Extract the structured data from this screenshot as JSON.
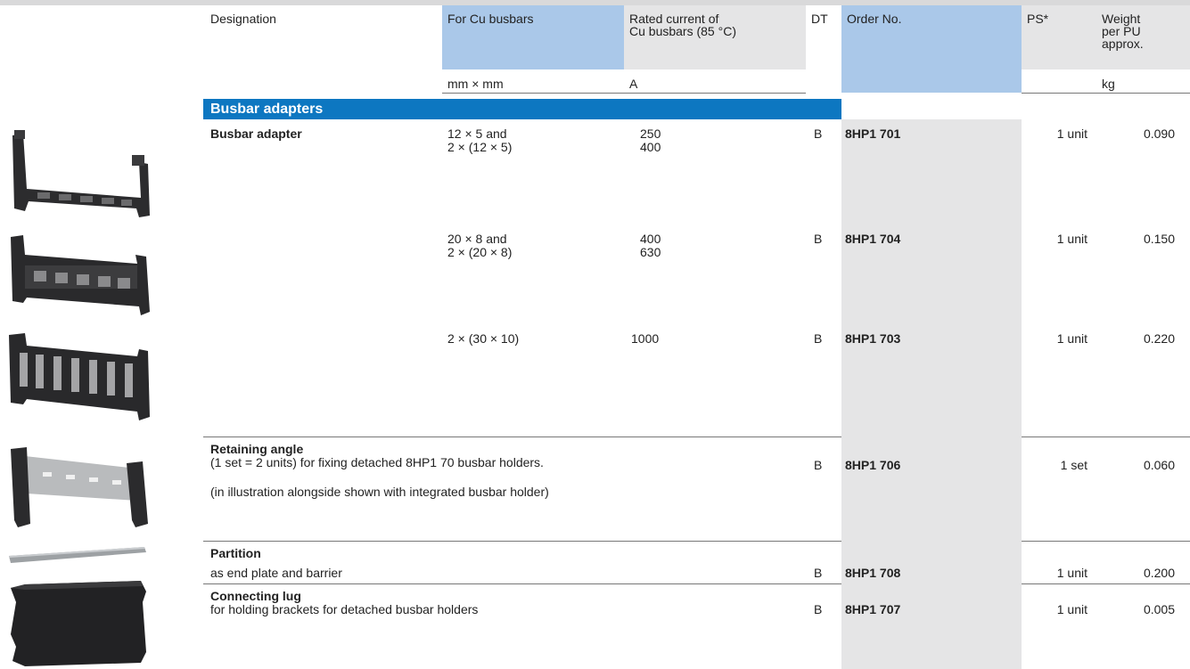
{
  "header": {
    "designation": "Designation",
    "cu_busbars": "For Cu busbars",
    "rated_current_l1": "Rated current of",
    "rated_current_l2": "Cu busbars (85 °C)",
    "dt": "DT",
    "order_no": "Order No.",
    "ps": "PS*",
    "weight_l1": "Weight",
    "weight_l2": "per PU",
    "weight_l3": "approx.",
    "unit_cu": "mm × mm",
    "unit_current": "A",
    "unit_weight": "kg"
  },
  "section": {
    "title": "Busbar adapters"
  },
  "rows": [
    {
      "designation": "Busbar adapter",
      "cu_l1": "12 × 5 and",
      "cu_l2": "2 × (12 × 5)",
      "current_l1": "250",
      "current_l2": "400",
      "dt": "B",
      "order": "8HP1 701",
      "ps": "1 unit",
      "weight": "0.090"
    },
    {
      "cu_l1": "20 × 8 and",
      "cu_l2": "2 × (20 × 8)",
      "current_l1": "400",
      "current_l2": "630",
      "dt": "B",
      "order": "8HP1 704",
      "ps": "1 unit",
      "weight": "0.150"
    },
    {
      "cu_l1": "2 × (30 × 10)",
      "current_l1": "1000",
      "dt": "B",
      "order": "8HP1 703",
      "ps": "1 unit",
      "weight": "0.220"
    },
    {
      "designation": "Retaining angle",
      "desc_l1": "(1 set = 2 units) for fixing detached 8HP1 70 busbar holders.",
      "desc_l2": "(in illustration alongside shown with integrated busbar holder)",
      "dt": "B",
      "order": "8HP1 706",
      "ps": "1 set",
      "weight": "0.060"
    },
    {
      "designation": "Partition",
      "desc_l1": "as end plate and barrier",
      "dt": "B",
      "order": "8HP1 708",
      "ps": "1 unit",
      "weight": "0.200"
    },
    {
      "designation": "Connecting lug",
      "desc_l1": "for holding brackets for detached busbar holders",
      "dt": "B",
      "order": "8HP1 707",
      "ps": "1 unit",
      "weight": "0.005"
    }
  ],
  "images": [
    {
      "icon": "busbar-adapter-small-icon"
    },
    {
      "icon": "busbar-adapter-medium-icon"
    },
    {
      "icon": "busbar-adapter-large-icon"
    },
    {
      "icon": "retaining-angle-icon"
    },
    {
      "icon": "partition-icon"
    },
    {
      "icon": "connecting-lug-icon"
    }
  ]
}
